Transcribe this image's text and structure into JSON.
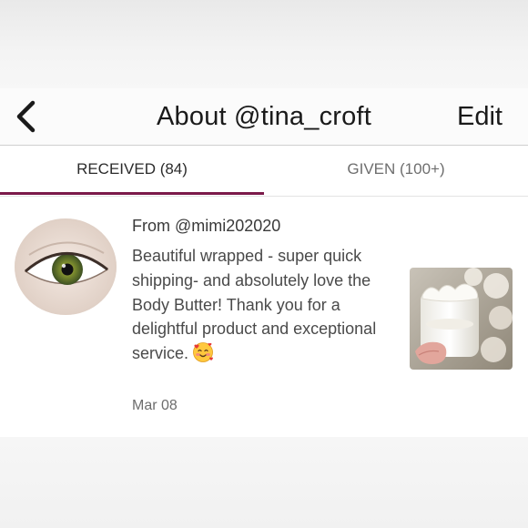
{
  "header": {
    "back_icon": "chevron-left-icon",
    "title": "About @tina_croft",
    "edit_label": "Edit"
  },
  "tabs": [
    {
      "label": "RECEIVED (84)",
      "active": true
    },
    {
      "label": "GIVEN (100+)",
      "active": false
    }
  ],
  "colors": {
    "accent": "#7b1a4a",
    "text_primary": "#1a1a1a",
    "text_secondary": "#6e6e6e"
  },
  "review": {
    "from": "From @mimi202020",
    "text": "Beautiful wrapped - super quick shipping- and absolutely love the Body Butter! Thank you for a delightful product and exceptional service.",
    "emoji": "🥰",
    "date": "Mar 08",
    "avatar_icon": "eye-avatar",
    "photo_icon": "body-butter-jar-photo"
  }
}
